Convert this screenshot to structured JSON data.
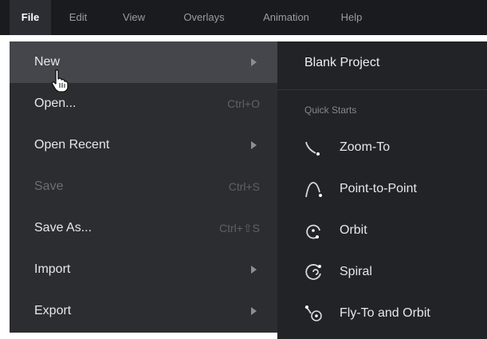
{
  "menubar": {
    "items": [
      {
        "label": "File",
        "active": true
      },
      {
        "label": "Edit"
      },
      {
        "label": "View"
      },
      {
        "label": "Overlays"
      },
      {
        "label": "Animation"
      },
      {
        "label": "Help"
      }
    ]
  },
  "file_menu": {
    "items": [
      {
        "label": "New",
        "has_submenu": true,
        "highlighted": true
      },
      {
        "label": "Open...",
        "shortcut": "Ctrl+O"
      },
      {
        "label": "Open Recent",
        "has_submenu": true
      },
      {
        "label": "Save",
        "shortcut": "Ctrl+S",
        "disabled": true
      },
      {
        "label": "Save As...",
        "shortcut": "Ctrl+⇧S"
      },
      {
        "label": "Import",
        "has_submenu": true
      },
      {
        "label": "Export",
        "has_submenu": true
      }
    ]
  },
  "new_submenu": {
    "blank_project": "Blank Project",
    "section_label": "Quick Starts",
    "quick_starts": [
      {
        "label": "Zoom-To",
        "icon": "zoom-to-icon"
      },
      {
        "label": "Point-to-Point",
        "icon": "point-to-point-icon"
      },
      {
        "label": "Orbit",
        "icon": "orbit-icon"
      },
      {
        "label": "Spiral",
        "icon": "spiral-icon"
      },
      {
        "label": "Fly-To and Orbit",
        "icon": "fly-to-orbit-icon"
      }
    ]
  },
  "colors": {
    "menubar_bg": "#1a1b1f",
    "menu_bg": "#2c2d31",
    "submenu_bg": "#222327",
    "highlight": "#45464b",
    "text": "#e6e7ea",
    "muted": "#5f6167"
  }
}
